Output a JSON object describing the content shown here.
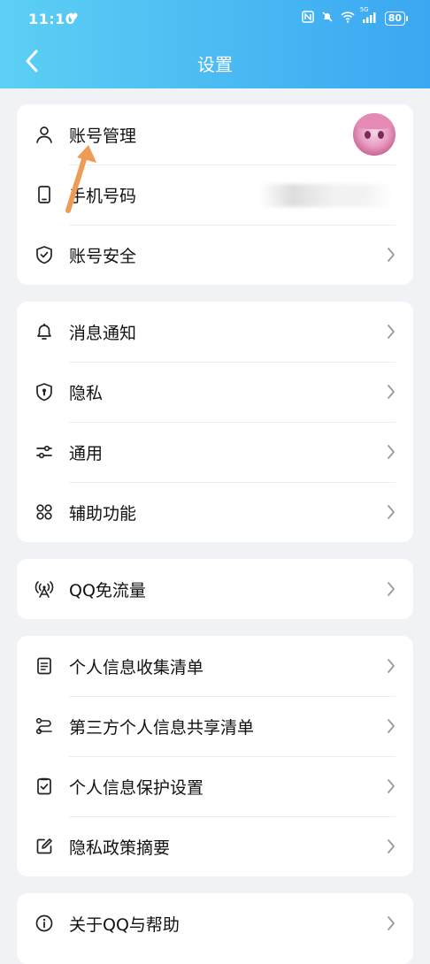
{
  "status_bar": {
    "time": "11:10",
    "network": "5G",
    "battery": "80"
  },
  "header": {
    "title": "设置",
    "gradient_start": "#5cd0f4",
    "gradient_end": "#3aa7f2"
  },
  "sections": {
    "account": {
      "items": [
        {
          "label": "账号管理",
          "icon": "person-icon"
        },
        {
          "label": "手机号码",
          "icon": "phone-icon"
        },
        {
          "label": "账号安全",
          "icon": "shield-check-icon"
        }
      ]
    },
    "general": {
      "items": [
        {
          "label": "消息通知",
          "icon": "bell-icon"
        },
        {
          "label": "隐私",
          "icon": "privacy-shield-icon"
        },
        {
          "label": "通用",
          "icon": "sliders-icon"
        },
        {
          "label": "辅助功能",
          "icon": "grid-icon"
        }
      ]
    },
    "data": {
      "items": [
        {
          "label": "QQ免流量",
          "icon": "signal-tower-icon"
        }
      ]
    },
    "personal_info": {
      "items": [
        {
          "label": "个人信息收集清单",
          "icon": "document-list-icon"
        },
        {
          "label": "第三方个人信息共享清单",
          "icon": "share-flow-icon"
        },
        {
          "label": "个人信息保护设置",
          "icon": "checkbox-doc-icon"
        },
        {
          "label": "隐私政策摘要",
          "icon": "edit-icon"
        }
      ]
    },
    "about": {
      "items": [
        {
          "label": "关于QQ与帮助",
          "icon": "info-icon"
        }
      ]
    }
  },
  "annotation": {
    "arrow_color": "#ee9b55"
  }
}
